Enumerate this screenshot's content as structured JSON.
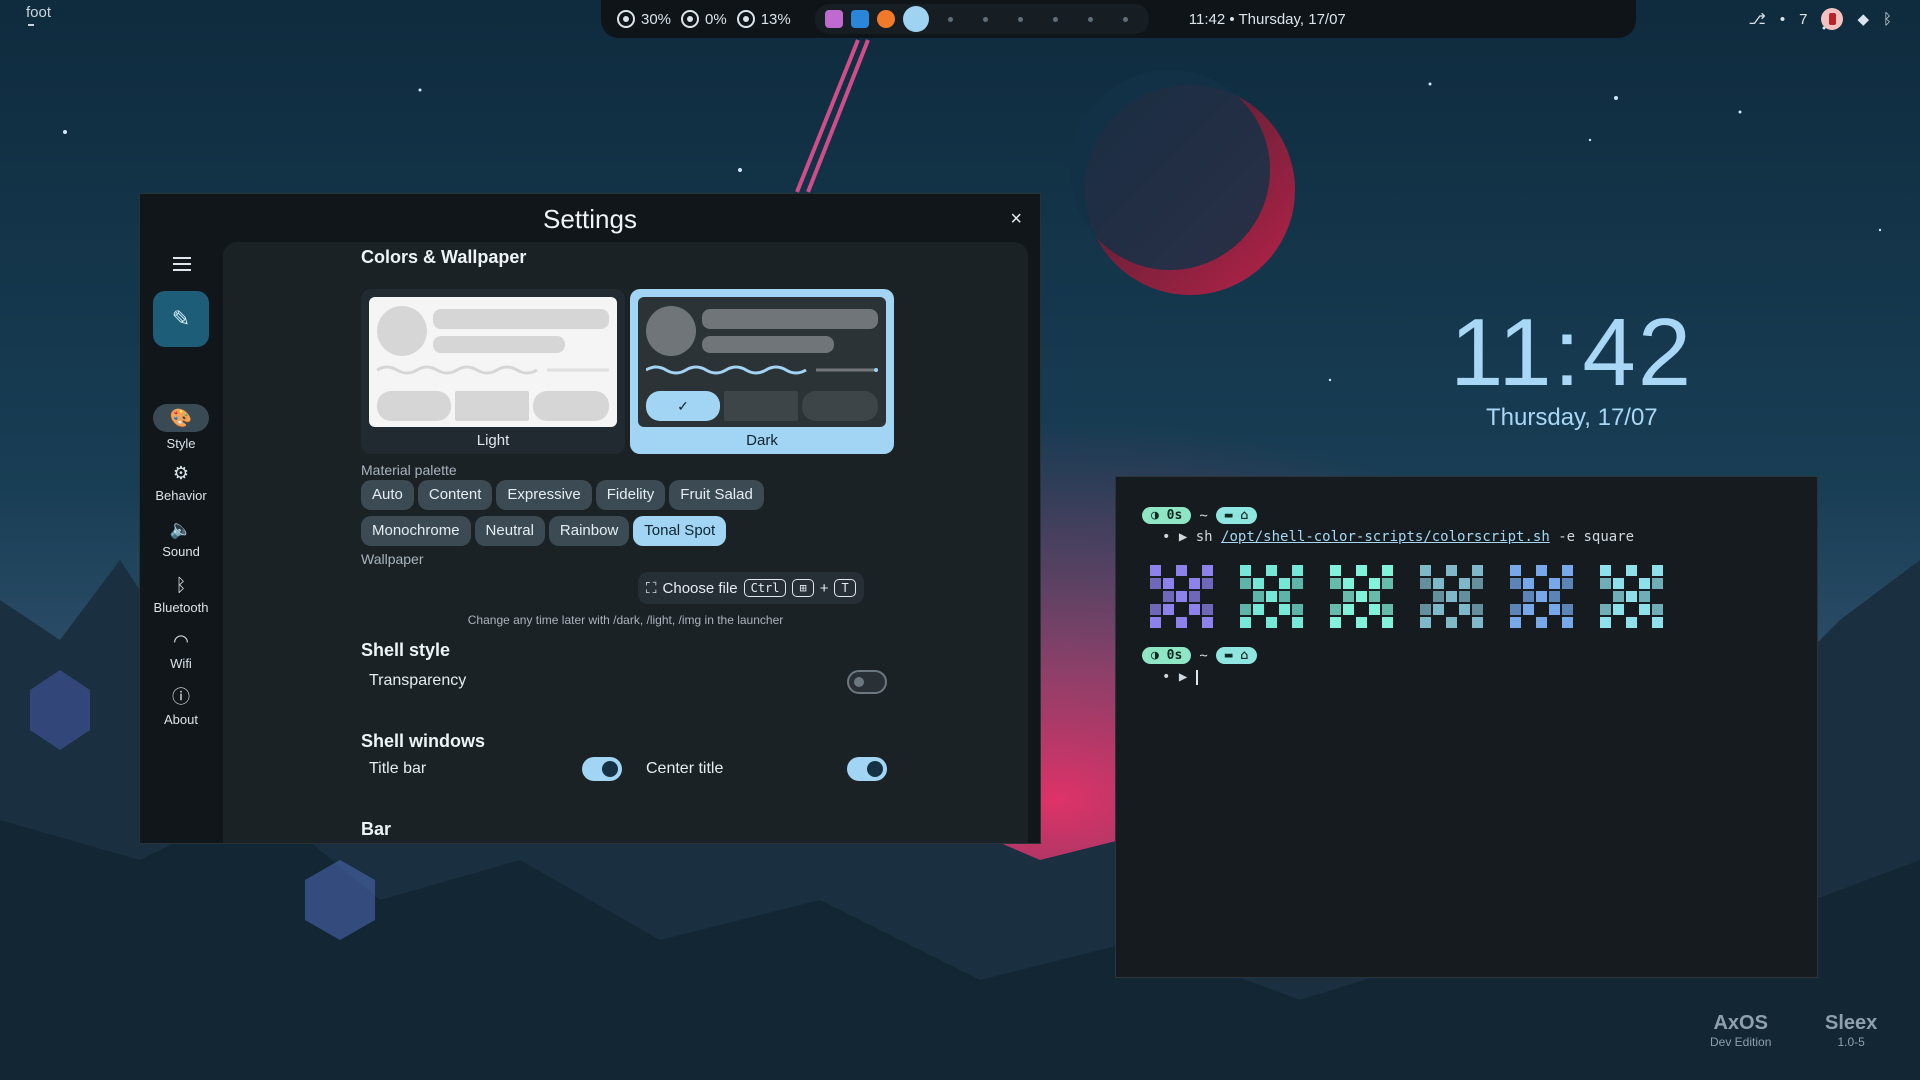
{
  "topbar": {
    "left_label": "foot",
    "cpu": "30%",
    "swap": "0%",
    "ram": "13%",
    "clock": "11:42 • Thursday, 17/07",
    "notification_count": "7"
  },
  "desktop": {
    "time": "11:42",
    "date": "Thursday, 17/07",
    "watermark_left": "AxOS",
    "watermark_left_sub": "Dev Edition",
    "watermark_right": "Sleex",
    "watermark_right_sub": "1.0-5"
  },
  "settings": {
    "title": "Settings",
    "close": "×",
    "nav": [
      {
        "label": "Style",
        "icon": "palette-icon"
      },
      {
        "label": "Behavior",
        "icon": "gear-icon"
      },
      {
        "label": "Sound",
        "icon": "speaker-icon"
      },
      {
        "label": "Bluetooth",
        "icon": "bluetooth-icon"
      },
      {
        "label": "Wifi",
        "icon": "wifi-icon"
      },
      {
        "label": "About",
        "icon": "info-icon"
      }
    ],
    "colors_section": "Colors & Wallpaper",
    "theme_light": "Light",
    "theme_dark": "Dark",
    "selected_theme": "Dark",
    "palette_label": "Material palette",
    "palette_row1": [
      "Auto",
      "Content",
      "Expressive",
      "Fidelity",
      "Fruit Salad"
    ],
    "palette_row2": [
      "Monochrome",
      "Neutral",
      "Rainbow",
      "Tonal Spot"
    ],
    "palette_selected": "Tonal Spot",
    "wallpaper_label": "Wallpaper",
    "choose_file": "Choose file",
    "kbd_ctrl": "Ctrl",
    "kbd_plus": "+",
    "kbd_t": "T",
    "wallpaper_hint": "Change any time later with /dark, /light, /img in the launcher",
    "shell_style": "Shell style",
    "transparency": "Transparency",
    "transparency_on": false,
    "shell_windows": "Shell windows",
    "title_bar": "Title bar",
    "title_bar_on": true,
    "center_title": "Center title",
    "center_title_on": true,
    "bar_section": "Bar"
  },
  "terminal": {
    "pill_time": "0s",
    "tilde": "~",
    "cmd_prefix": "sh",
    "cmd_path": "/opt/shell-color-scripts/colorscript.sh",
    "cmd_args": "-e square",
    "colors": [
      "#8d82ec",
      "#76e8d8",
      "#82f2da",
      "#7fb8c8",
      "#76a8ea",
      "#8ee0ea"
    ]
  }
}
